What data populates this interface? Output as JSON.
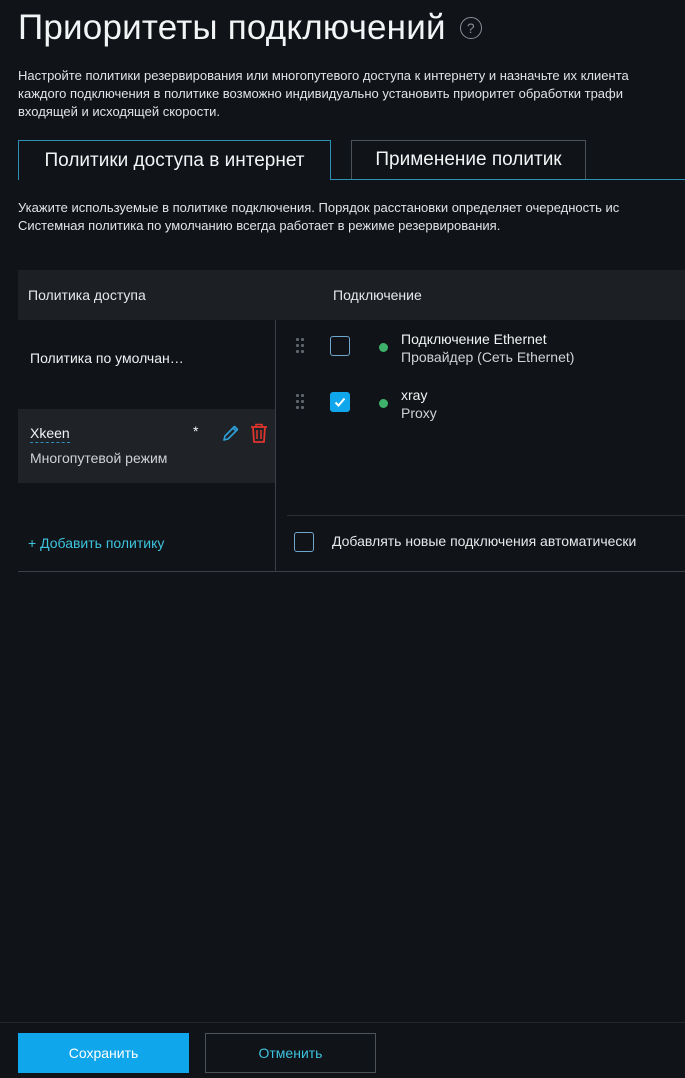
{
  "header": {
    "title": "Приоритеты подключений",
    "help_icon": "question-circle-icon",
    "help_glyph": "?",
    "description_lines": [
      "Настройте политики резервирования или многопутевого доступа к интернету и назначьте их клиента",
      "каждого подключения в политике возможно индивидуально установить приоритет обработки трафи",
      "входящей и исходящей скорости."
    ]
  },
  "tabs": [
    {
      "label": "Политики доступа в интернет",
      "active": true
    },
    {
      "label": "Применение политик",
      "active": false
    }
  ],
  "hint_lines": [
    "Укажите используемые в политике подключения. Порядок расстановки определяет очередность ис",
    "Системная политика по умолчанию всегда работает в режиме резервирования."
  ],
  "table": {
    "col_policy": "Политика доступа",
    "col_connection": "Подключение"
  },
  "policies": [
    {
      "name": "Политика по умолчан…"
    },
    {
      "name": "Xkeen",
      "marker": "*",
      "mode": "Многопутевой режим",
      "icons": [
        "pencil-icon",
        "trash-icon"
      ]
    }
  ],
  "add_policy_label": "+ Добавить политику",
  "connections": [
    {
      "name": "Подключение Ethernet",
      "sub": "Провайдер (Сеть Ethernet)",
      "checked": false,
      "status_color": "#3eb26a"
    },
    {
      "name": "xray",
      "sub": "Proxy",
      "checked": true,
      "status_color": "#3eb26a"
    }
  ],
  "auto_add": {
    "label": "Добавлять новые подключения автоматически",
    "checked": false
  },
  "footer": {
    "save_label": "Сохранить",
    "cancel_label": "Отменить"
  },
  "colors": {
    "accent": "#0fa6ec",
    "link": "#3ec3de",
    "danger": "#e0342c",
    "background": "#101317"
  }
}
